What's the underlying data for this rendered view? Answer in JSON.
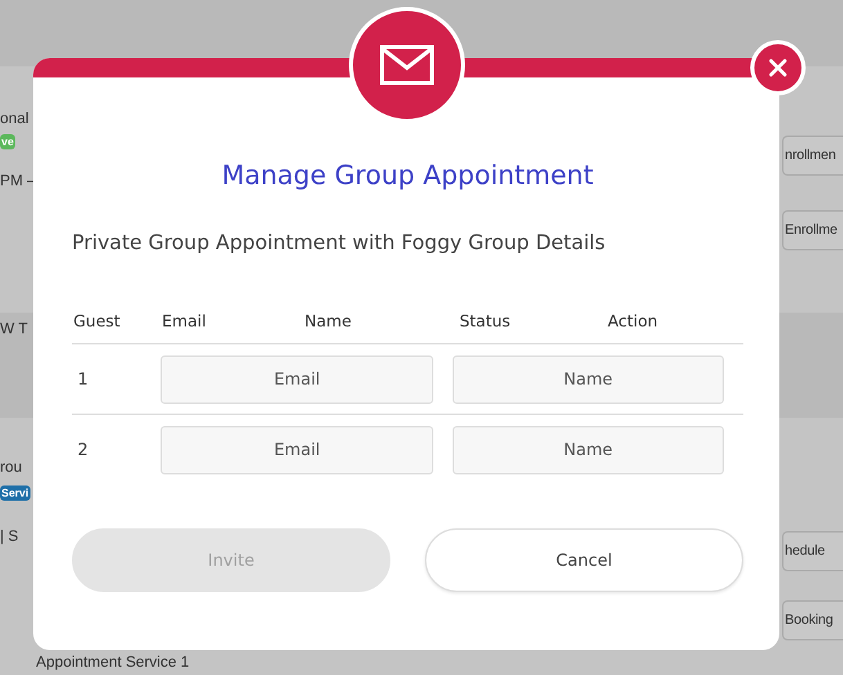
{
  "background": {
    "items": [
      {
        "kind": "text",
        "text": "onal"
      },
      {
        "kind": "badge",
        "text": "ve",
        "color": "#5cb85c"
      },
      {
        "kind": "text",
        "text": "PM –"
      },
      {
        "kind": "text",
        "text": "W   T"
      },
      {
        "kind": "text",
        "text": "rou"
      },
      {
        "kind": "badge",
        "text": "Servi",
        "color": "#1e6fa8"
      },
      {
        "kind": "text",
        "text": "|   S"
      },
      {
        "kind": "text",
        "text": "Appointment Service 1"
      },
      {
        "kind": "button",
        "text": "nrollmen"
      },
      {
        "kind": "button",
        "text": "Enrollme"
      },
      {
        "kind": "button",
        "text": "hedule"
      },
      {
        "kind": "button",
        "text": "Booking"
      }
    ]
  },
  "modal": {
    "title": "Manage Group Appointment",
    "subtitle": "Private Group Appointment with Foggy Group Details",
    "columns": [
      "Guest",
      "Email",
      "Name",
      "Status",
      "Action"
    ],
    "rows": [
      {
        "guest": "1",
        "email_placeholder": "Email",
        "name_placeholder": "Name"
      },
      {
        "guest": "2",
        "email_placeholder": "Email",
        "name_placeholder": "Name"
      }
    ],
    "buttons": [
      {
        "label": "Invite",
        "disabled": true
      },
      {
        "label": "Cancel",
        "disabled": false
      }
    ]
  }
}
